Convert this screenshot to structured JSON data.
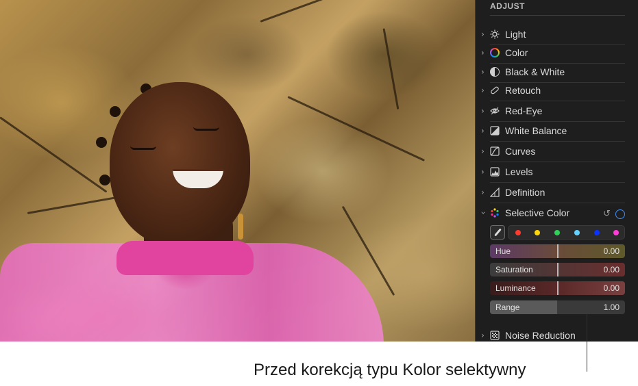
{
  "panel": {
    "header": "ADJUST",
    "items": [
      {
        "label": "Light",
        "icon": "sun-icon"
      },
      {
        "label": "Color",
        "icon": "color-wheel-icon"
      },
      {
        "label": "Black & White",
        "icon": "half-circle-icon"
      },
      {
        "label": "Retouch",
        "icon": "bandage-icon"
      },
      {
        "label": "Red-Eye",
        "icon": "eye-icon"
      },
      {
        "label": "White Balance",
        "icon": "white-balance-icon"
      },
      {
        "label": "Curves",
        "icon": "curves-icon"
      },
      {
        "label": "Levels",
        "icon": "levels-icon"
      },
      {
        "label": "Definition",
        "icon": "triangle-icon"
      }
    ],
    "selective_color": {
      "label": "Selective Color",
      "swatch_colors": [
        "#ff3b30",
        "#ffd60a",
        "#30d158",
        "#64d2ff",
        "#0a32ff",
        "#ff3bd8"
      ],
      "sliders": [
        {
          "label": "Hue",
          "value": "0.00",
          "color": "#5c3a66"
        },
        {
          "label": "Saturation",
          "value": "0.00",
          "color": "#6a2e2e"
        },
        {
          "label": "Luminance",
          "value": "0.00",
          "color": "#5a2828"
        },
        {
          "label": "Range",
          "value": "1.00",
          "color": "#4c4c4c"
        }
      ]
    },
    "noise_reduction": {
      "label": "Noise Reduction"
    }
  },
  "caption": "Przed korekcją typu Kolor selektywny"
}
